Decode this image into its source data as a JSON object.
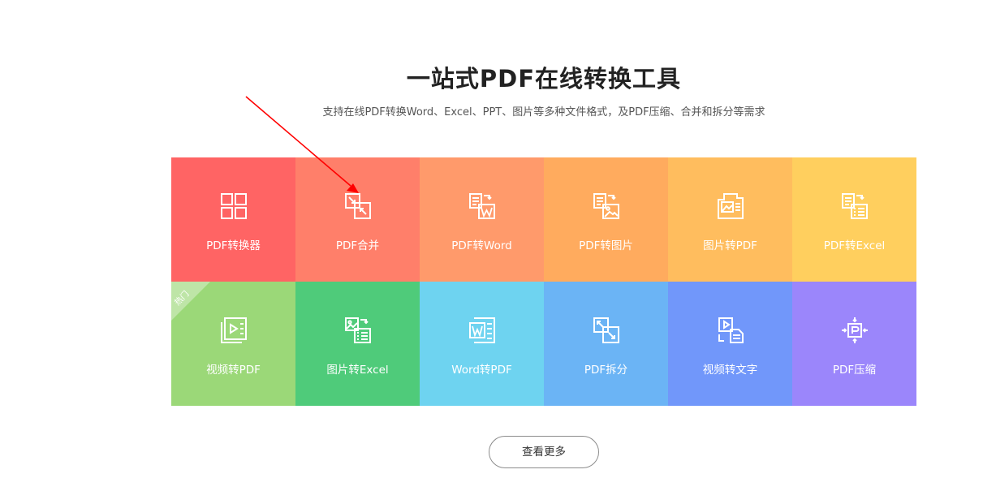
{
  "header": {
    "title": "一站式PDF在线转换工具",
    "subtitle": "支持在线PDF转换Word、Excel、PPT、图片等多种文件格式，及PDF压缩、合并和拆分等需求"
  },
  "tools": [
    {
      "label": "PDF转换器",
      "icon": "grid-icon",
      "color": "#ff6464"
    },
    {
      "label": "PDF合并",
      "icon": "merge-icon",
      "color": "#ff7f6a"
    },
    {
      "label": "PDF转Word",
      "icon": "pdf-to-word-icon",
      "color": "#ff9a6b"
    },
    {
      "label": "PDF转图片",
      "icon": "pdf-to-image-icon",
      "color": "#ffab5e"
    },
    {
      "label": "图片转PDF",
      "icon": "image-to-pdf-icon",
      "color": "#ffbd5e"
    },
    {
      "label": "PDF转Excel",
      "icon": "pdf-to-excel-icon",
      "color": "#ffcf5e"
    },
    {
      "label": "视频转PDF",
      "icon": "video-to-pdf-icon",
      "color": "#9bd878",
      "badge": "热门"
    },
    {
      "label": "图片转Excel",
      "icon": "image-to-excel-icon",
      "color": "#4fcb7a"
    },
    {
      "label": "Word转PDF",
      "icon": "word-to-pdf-icon",
      "color": "#6ed3f0"
    },
    {
      "label": "PDF拆分",
      "icon": "split-icon",
      "color": "#6bb4f5"
    },
    {
      "label": "视频转文字",
      "icon": "video-to-text-icon",
      "color": "#7197fa"
    },
    {
      "label": "PDF压缩",
      "icon": "compress-icon",
      "color": "#9b86fb"
    }
  ],
  "more_button": {
    "label": "查看更多"
  },
  "annotation": {
    "arrow_color": "#ff0000"
  }
}
